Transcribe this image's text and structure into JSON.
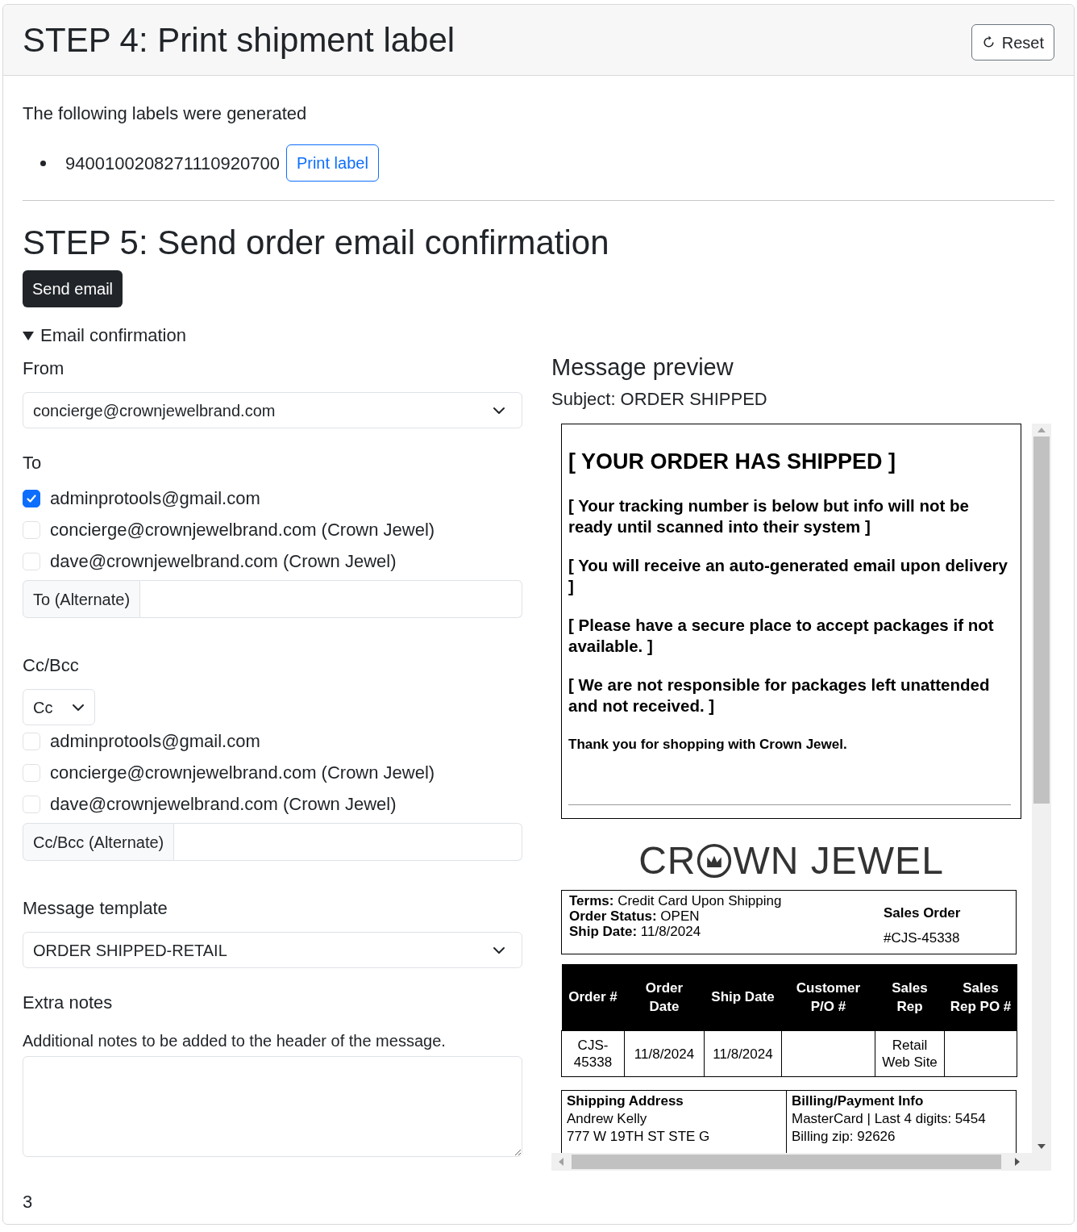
{
  "step4": {
    "title": "STEP 4: Print shipment label",
    "reset_button": "Reset",
    "intro": "The following labels were generated",
    "labels": [
      {
        "tracking": "9400100208271110920700",
        "button": "Print label"
      }
    ]
  },
  "step5": {
    "title": "STEP 5: Send order email confirmation",
    "send_button": "Send email",
    "details": {
      "summary": "Email confirmation",
      "expanded": true
    }
  },
  "form": {
    "from": {
      "label": "From",
      "value": "concierge@crownjewelbrand.com"
    },
    "to": {
      "label": "To",
      "recipients": [
        {
          "label": "adminprotools@gmail.com",
          "checked": true
        },
        {
          "label": "concierge@crownjewelbrand.com (Crown Jewel)",
          "checked": false
        },
        {
          "label": "dave@crownjewelbrand.com (Crown Jewel)",
          "checked": false
        }
      ],
      "alternate": {
        "label": "To (Alternate)"
      }
    },
    "cc": {
      "label": "Cc/Bcc",
      "mode": "Cc",
      "recipients": [
        {
          "label": "adminprotools@gmail.com",
          "checked": false
        },
        {
          "label": "concierge@crownjewelbrand.com (Crown Jewel)",
          "checked": false
        },
        {
          "label": "dave@crownjewelbrand.com (Crown Jewel)",
          "checked": false
        }
      ],
      "alternate": {
        "label": "Cc/Bcc (Alternate)"
      }
    },
    "template": {
      "label": "Message template",
      "value": "ORDER SHIPPED-RETAIL"
    },
    "extra_notes": {
      "label": "Extra notes",
      "help": "Additional notes to be added to the header of the message."
    }
  },
  "preview": {
    "title": "Message preview",
    "subject": "Subject: ORDER SHIPPED",
    "email": {
      "heading": "[ YOUR ORDER HAS SHIPPED ]",
      "paragraphs": [
        "[ Your tracking number is below but info will not be ready until scanned into their system ]",
        "[ You will receive an auto-generated email upon delivery ]",
        "[ Please have a secure place to accept packages if not available. ]",
        "[ We are not responsible for packages left unattended and not received. ]"
      ],
      "thanks": "Thank you for shopping with Crown Jewel."
    },
    "logo": {
      "text_before": "CR",
      "text_after": "WN JEWEL"
    },
    "info": {
      "lines": [
        "**Terms:** Credit Card Upon Shipping",
        "**Order Status:** OPEN",
        "**Ship Date:** 11/8/2024"
      ],
      "sales_order_label": "Sales Order",
      "sales_order": "#CJS-45338"
    },
    "table": {
      "columns": [
        "Order #",
        "Order Date",
        "Ship Date",
        "Customer P/O #",
        "Sales Rep",
        "Sales Rep PO #"
      ],
      "rows": [
        [
          "CJS-45338",
          "11/8/2024",
          "11/8/2024",
          "",
          "Retail Web Site",
          ""
        ]
      ]
    },
    "address": {
      "shipping_title": "Shipping Address",
      "shipping_lines": [
        "Andrew Kelly",
        "777 W 19TH ST STE G"
      ],
      "billing_title": "Billing/Payment Info",
      "billing_lines": [
        "MasterCard | Last 4 digits: 5454",
        "Billing zip: 92626"
      ]
    }
  },
  "footer": "3"
}
